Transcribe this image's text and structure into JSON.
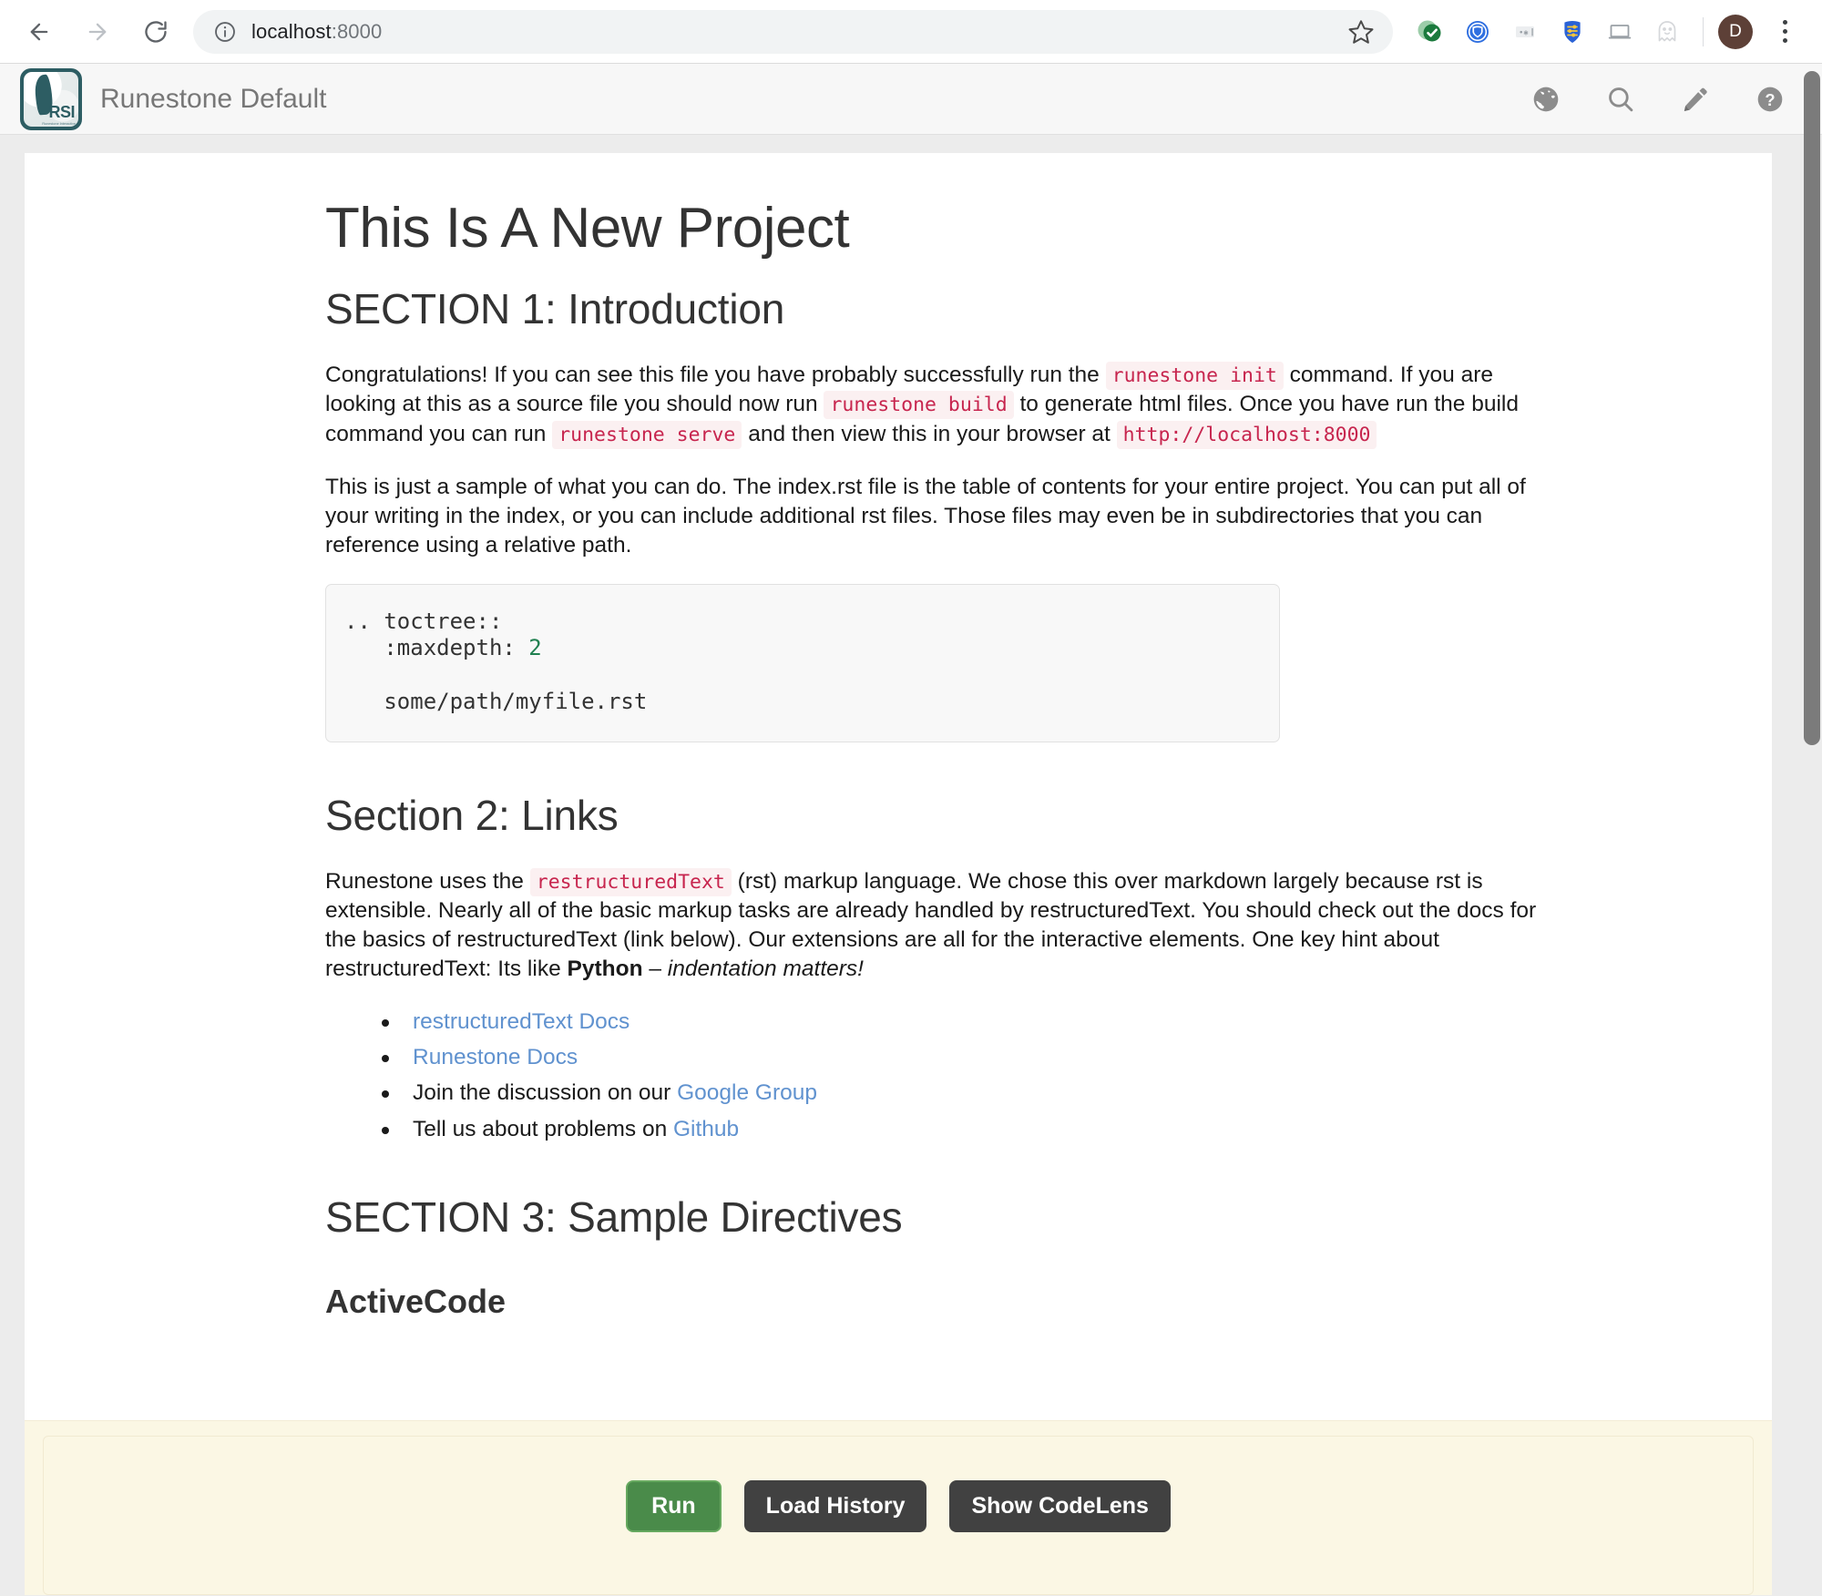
{
  "browser": {
    "back_label": "Back",
    "forward_label": "Forward",
    "reload_label": "Reload",
    "info_icon": "info-circle-icon",
    "url_host": "localhost",
    "url_port": ":8000",
    "url_full": "localhost:8000",
    "bookmark_icon": "star-icon",
    "extensions": [
      {
        "name": "green-check-extension-icon",
        "title": ""
      },
      {
        "name": "blue-shield-extension-icon",
        "title": ""
      },
      {
        "name": "password-field-extension-icon",
        "title": ""
      },
      {
        "name": "blue-shield-sliders-extension-icon",
        "title": ""
      },
      {
        "name": "laptop-extension-icon",
        "title": ""
      },
      {
        "name": "ghost-extension-icon",
        "title": ""
      }
    ],
    "profile_initial": "D",
    "menu_icon": "three-dot-menu-icon"
  },
  "navbar": {
    "logo_alt": "runestone-logo",
    "logo_text": "RSI",
    "logo_subtext": "Runestone Interactive",
    "title": "Runestone Default",
    "actions": [
      {
        "name": "globe-icon",
        "label": "Language"
      },
      {
        "name": "search-icon",
        "label": "Search"
      },
      {
        "name": "pencil-icon",
        "label": "Edit"
      },
      {
        "name": "help-icon",
        "label": "Help"
      }
    ]
  },
  "doc": {
    "title": "This Is A New Project",
    "section1": {
      "heading": "SECTION 1: Introduction",
      "p1": {
        "a": "Congratulations! If you can see this file you have probably successfully run the ",
        "code1": "runestone init",
        "b": " command. If you are looking at this as a source file you should now run ",
        "code2": "runestone build",
        "c": " to generate html files. Once you have run the build command you can run ",
        "code3": "runestone serve",
        "d": " and then view this in your browser at ",
        "code4": "http://localhost:8000"
      },
      "p2": "This is just a sample of what you can do. The index.rst file is the table of contents for your entire project. You can put all of your writing in the index, or you can include additional rst files. Those files may even be in subdirectories that you can reference using a relative path.",
      "codeblock_line1": ".. toctree::",
      "codeblock_line2": "   :maxdepth: ",
      "codeblock_maxdepth_value": "2",
      "codeblock_line3": "",
      "codeblock_line4": "   some/path/myfile.rst"
    },
    "section2": {
      "heading": "Section 2: Links",
      "p1": {
        "a": "Runestone uses the ",
        "code1": "restructuredText",
        "b": " (rst) markup language. We chose this over markdown largely because rst is extensible. Nearly all of the basic markup tasks are already handled by restructuredText. You should check out the docs for the basics of restructuredText (link below). Our extensions are all for the interactive elements. One key hint about restructuredText: Its like ",
        "strong": "Python",
        "c": " – ",
        "em": "indentation matters!"
      },
      "links": [
        {
          "prefix": "",
          "link": "restructuredText Docs",
          "suffix": ""
        },
        {
          "prefix": "",
          "link": "Runestone Docs",
          "suffix": ""
        },
        {
          "prefix": "Join the discussion on our ",
          "link": "Google Group",
          "suffix": ""
        },
        {
          "prefix": "Tell us about problems on ",
          "link": "Github",
          "suffix": ""
        }
      ]
    },
    "section3": {
      "heading": "SECTION 3: Sample Directives",
      "subheading": "ActiveCode",
      "buttons": {
        "run": "Run",
        "load_history": "Load History",
        "show_codelens": "Show CodeLens"
      }
    }
  },
  "colors": {
    "code_text": "#c7254e",
    "code_bg": "#fbf0f1",
    "link": "#6092cf",
    "run_button": "#4a8b4a",
    "dark_button": "#414141",
    "activecode_bg": "#fbf7e4",
    "brand_teal": "#2d5d63"
  }
}
